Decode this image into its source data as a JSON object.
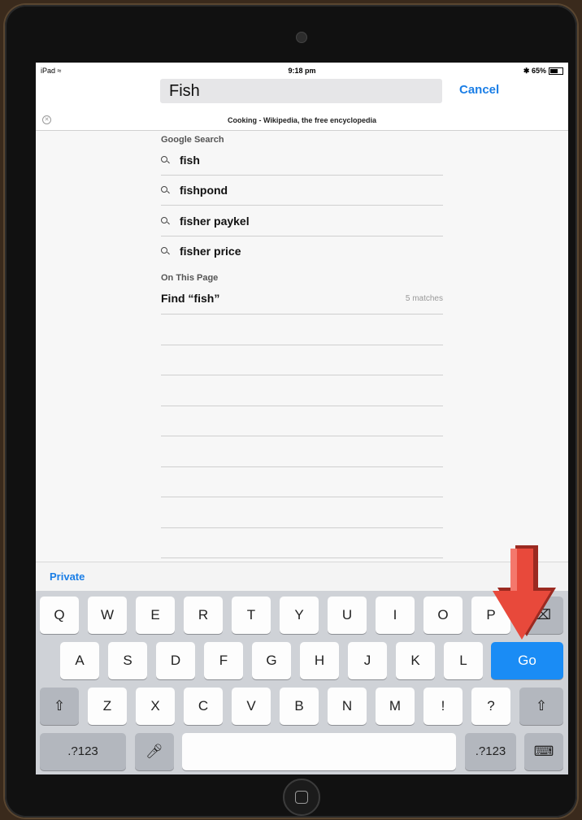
{
  "status_bar": {
    "device": "iPad",
    "time": "9:18 pm",
    "battery": "65%"
  },
  "address_bar": {
    "query": "Fish",
    "cancel_label": "Cancel"
  },
  "tab": {
    "title": "Cooking - Wikipedia, the free encyclopedia"
  },
  "google_search": {
    "heading": "Google Search",
    "suggestions": [
      "fish",
      "fishpond",
      "fisher paykel",
      "fisher price"
    ]
  },
  "on_this_page": {
    "heading": "On This Page",
    "find_label": "Find “fish”",
    "matches": "5 matches"
  },
  "private_label": "Private",
  "keyboard": {
    "row1": [
      "Q",
      "W",
      "E",
      "R",
      "T",
      "Y",
      "U",
      "I",
      "O",
      "P"
    ],
    "row2": [
      "A",
      "S",
      "D",
      "F",
      "G",
      "H",
      "J",
      "K",
      "L"
    ],
    "go_label": "Go",
    "row3": [
      "Z",
      "X",
      "C",
      "V",
      "B",
      "N",
      "M",
      "!",
      "?"
    ],
    "numbers_label": ".?123"
  },
  "colors": {
    "accent": "#1a7ee6",
    "go_key": "#1a8cf5",
    "arrow": "#e8493b"
  }
}
